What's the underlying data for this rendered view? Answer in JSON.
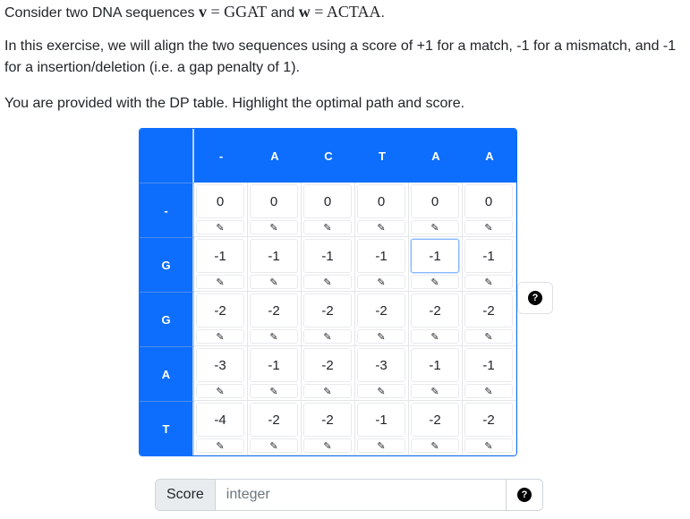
{
  "intro": {
    "prefix": "Consider two DNA sequences ",
    "v_var": "v",
    "v_eq": " = ",
    "v_val": "GGAT",
    "mid": " and ",
    "w_var": "w",
    "w_eq": " = ",
    "w_val": "ACTAA",
    "suffix": "."
  },
  "instructions": "In this exercise, we will align the two sequences using a score of +1 for a match, -1 for a mismatch, and -1 for a insertion/deletion (i.e. a gap penalty of 1).",
  "task": "You are provided with the DP table. Highlight the optimal path and score.",
  "table": {
    "corner": "",
    "col_headers": [
      "-",
      "A",
      "C",
      "T",
      "A",
      "A"
    ],
    "row_headers": [
      "-",
      "G",
      "G",
      "A",
      "T"
    ],
    "values": [
      [
        "0",
        "0",
        "0",
        "0",
        "0",
        "0"
      ],
      [
        "-1",
        "-1",
        "-1",
        "-1",
        "-1",
        "-1"
      ],
      [
        "-2",
        "-2",
        "-2",
        "-2",
        "-2",
        "-2"
      ],
      [
        "-3",
        "-1",
        "-2",
        "-3",
        "-1",
        "-1"
      ],
      [
        "-4",
        "-2",
        "-2",
        "-1",
        "-2",
        "-2"
      ]
    ],
    "pen_glyph": "✎",
    "focused_cell": {
      "row": 1,
      "col": 4
    }
  },
  "help_icon_glyph": "?",
  "score": {
    "label": "Score",
    "placeholder": "integer",
    "value": ""
  }
}
